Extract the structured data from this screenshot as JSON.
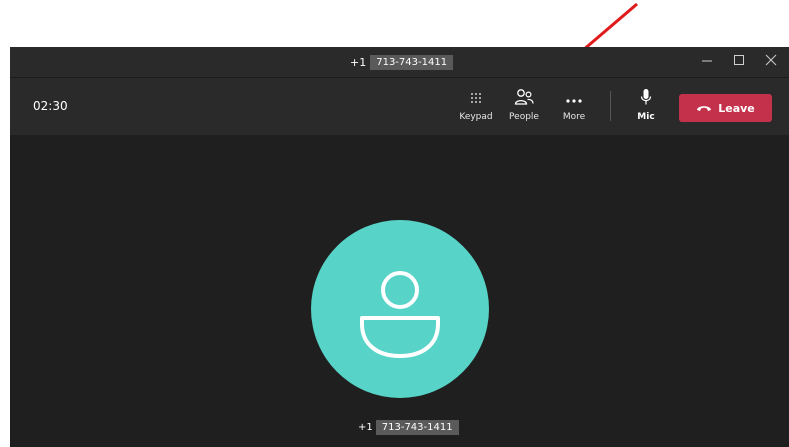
{
  "window": {
    "title_prefix": "+1",
    "title_number": "713-743-1411"
  },
  "toolbar": {
    "timer": "02:30",
    "buttons": [
      {
        "label": "Keypad",
        "icon": "keypad-icon"
      },
      {
        "label": "People",
        "icon": "people-icon"
      },
      {
        "label": "More",
        "icon": "more-icon"
      },
      {
        "label": "Mic",
        "icon": "mic-icon"
      }
    ],
    "leave_label": "Leave"
  },
  "call": {
    "caller_prefix": "+1",
    "caller_number": "713-743-1411"
  },
  "colors": {
    "window_bg": "#1f1f1f",
    "toolbar_bg": "#2a2a2a",
    "leave_bg": "#c4314b",
    "avatar_bg": "#57d3c8",
    "annotation_arrow": "#e01b1b"
  }
}
